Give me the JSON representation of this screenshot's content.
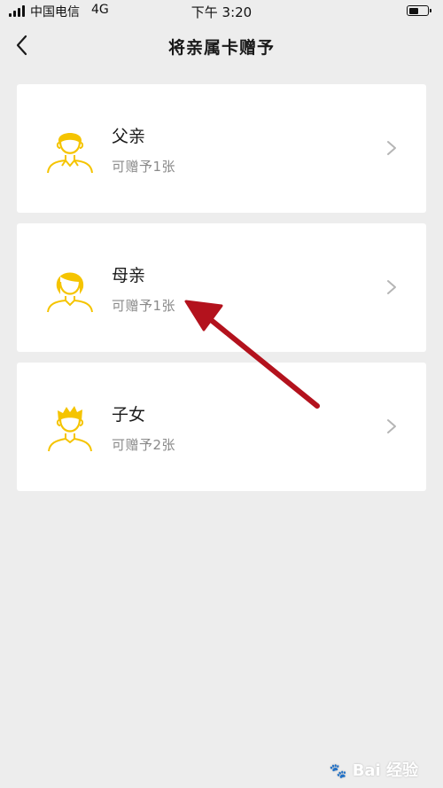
{
  "status_bar": {
    "carrier": "中国电信",
    "network": "4G",
    "time": "下午 3:20"
  },
  "nav": {
    "title": "将亲属卡赠予"
  },
  "items": [
    {
      "name": "父亲",
      "subtitle": "可赠予1张",
      "icon": "father-avatar-icon"
    },
    {
      "name": "母亲",
      "subtitle": "可赠予1张",
      "icon": "mother-avatar-icon"
    },
    {
      "name": "子女",
      "subtitle": "可赠予2张",
      "icon": "child-avatar-icon"
    }
  ],
  "colors": {
    "background": "#ededed",
    "card": "#ffffff",
    "icon_accent": "#f5c400",
    "annotation_arrow": "#b3121d",
    "subtitle": "#8a8a8a"
  },
  "watermark": {
    "text": "Bai 经验"
  }
}
